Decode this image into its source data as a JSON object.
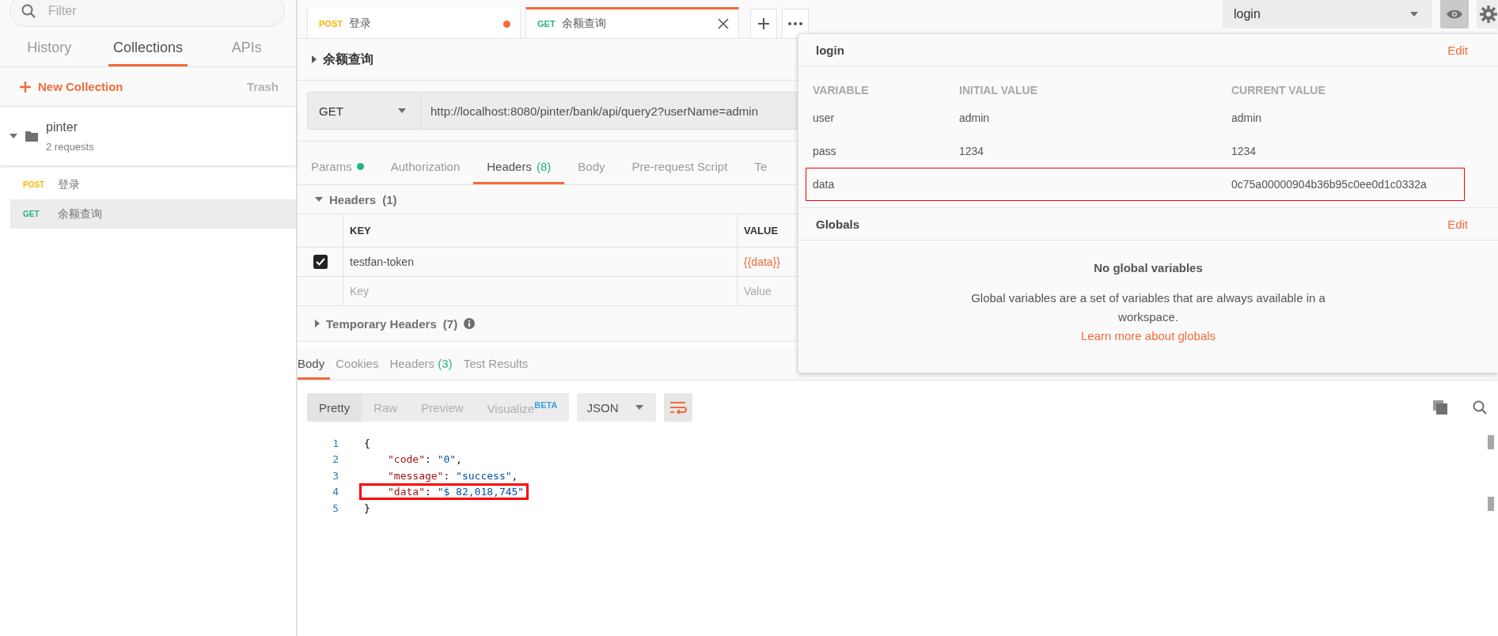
{
  "sidebar": {
    "search": {
      "placeholder": "Filter"
    },
    "tabs": [
      {
        "label": "History",
        "selected": false
      },
      {
        "label": "Collections",
        "selected": true
      },
      {
        "label": "APIs",
        "selected": false
      }
    ],
    "new_collection": "New Collection",
    "trash": "Trash",
    "collections": [
      {
        "name": "pinter",
        "count": "2 requests",
        "expanded": true,
        "children": [
          {
            "method": "POST",
            "color": "#ffb400",
            "name": "登录",
            "selected": false
          },
          {
            "method": "GET",
            "color": "#26b47f",
            "name": "余额查询",
            "selected": true
          }
        ]
      }
    ]
  },
  "request_tabs": [
    {
      "method": "POST",
      "color": "#ffb400",
      "name": "登录",
      "selected": false,
      "unsaved": true
    },
    {
      "method": "GET",
      "color": "#26b47f",
      "name": "余额查询",
      "selected": true,
      "unsaved": false
    }
  ],
  "request": {
    "title": "余额查询",
    "expanded": false,
    "method": "GET",
    "url": "http://localhost:8080/pinter/bank/api/query2?userName=admin",
    "tabs": [
      {
        "label": "Params",
        "selected": false,
        "dot": true
      },
      {
        "label": "Authorization",
        "selected": false,
        "dot": false
      },
      {
        "label": "Headers",
        "count": "(8)",
        "selected": true,
        "dot": false
      },
      {
        "label": "Body",
        "selected": false,
        "dot": false
      },
      {
        "label": "Pre-request Script",
        "selected": false,
        "dot": false
      },
      {
        "label": "Te",
        "selected": false,
        "dot": false
      }
    ],
    "headers_section": {
      "title": "Headers",
      "count": "(1)",
      "expanded": true
    },
    "headers_table": {
      "columns": [
        "KEY",
        "VALUE"
      ],
      "rows": [
        {
          "checked": true,
          "key": "testfan-token",
          "value": "{{data}}"
        }
      ],
      "new_row": {
        "key_placeholder": "Key",
        "value_placeholder": "Value"
      }
    },
    "temporary_headers": {
      "title": "Temporary Headers",
      "count": "(7)",
      "expanded": false
    }
  },
  "response": {
    "tabs": [
      {
        "label": "Body",
        "selected": true
      },
      {
        "label": "Cookies",
        "selected": false
      },
      {
        "label": "Headers",
        "count": "(3)",
        "selected": false
      },
      {
        "label": "Test Results",
        "selected": false
      }
    ],
    "view_modes": [
      {
        "label": "Pretty",
        "selected": true
      },
      {
        "label": "Raw",
        "selected": false
      },
      {
        "label": "Preview",
        "selected": false
      },
      {
        "label": "Visualize",
        "badge": "BETA",
        "selected": false
      }
    ],
    "format": "JSON",
    "wrap_lines": true,
    "code_lines": [
      {
        "number": "1",
        "highlighted": false,
        "tokens": [
          {
            "kind": "punct",
            "text": "{"
          }
        ]
      },
      {
        "number": "2",
        "highlighted": false,
        "tokens": [
          {
            "kind": "key",
            "text": "\"code\""
          },
          {
            "kind": "punct",
            "text": ": "
          },
          {
            "kind": "string",
            "text": "\"0\""
          },
          {
            "kind": "punct",
            "text": ","
          }
        ]
      },
      {
        "number": "3",
        "highlighted": false,
        "tokens": [
          {
            "kind": "key",
            "text": "\"message\""
          },
          {
            "kind": "punct",
            "text": ": "
          },
          {
            "kind": "string",
            "text": "\"success\""
          },
          {
            "kind": "punct",
            "text": ","
          }
        ]
      },
      {
        "number": "4",
        "highlighted": true,
        "tokens": [
          {
            "kind": "key",
            "text": "\"data\""
          },
          {
            "kind": "punct",
            "text": ": "
          },
          {
            "kind": "string",
            "text": "\"$ 82,018,745\""
          }
        ]
      },
      {
        "number": "5",
        "highlighted": false,
        "tokens": [
          {
            "kind": "punct",
            "text": "}"
          }
        ]
      }
    ]
  },
  "environment": {
    "selected": "login"
  },
  "environment_popup": {
    "name": "login",
    "edit": "Edit",
    "columns": [
      "VARIABLE",
      "INITIAL VALUE",
      "CURRENT VALUE"
    ],
    "rows": [
      {
        "variable": "user",
        "initial": "admin",
        "current": "admin",
        "highlighted": false
      },
      {
        "variable": "pass",
        "initial": "1234",
        "current": "1234",
        "highlighted": false
      },
      {
        "variable": "data",
        "current": "0c75a00000904b36b95c0ee0d1c0332a",
        "highlighted": true
      }
    ],
    "globals": {
      "title": "Globals",
      "edit": "Edit",
      "empty_title": "No global variables",
      "message": "Global variables are a set of variables that are always available in a workspace.",
      "link": "Learn more about globals"
    }
  }
}
